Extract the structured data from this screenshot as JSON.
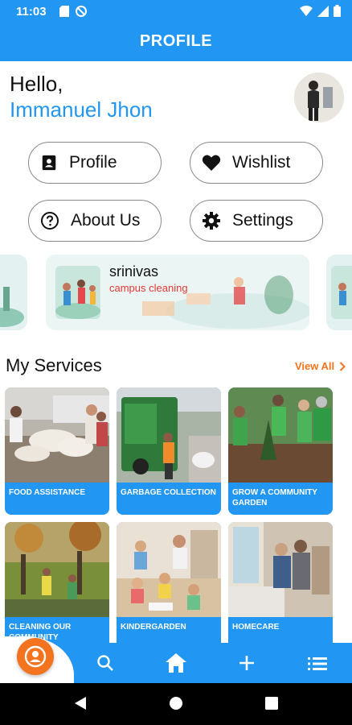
{
  "status_bar": {
    "time": "11:03"
  },
  "app_bar": {
    "title": "PROFILE"
  },
  "greeting": {
    "hello": "Hello,",
    "name": "Immanuel Jhon"
  },
  "menu": [
    {
      "label": "Profile",
      "icon": "contact-card-icon"
    },
    {
      "label": "Wishlist",
      "icon": "heart-icon"
    },
    {
      "label": "About Us",
      "icon": "help-circle-icon"
    },
    {
      "label": "Settings",
      "icon": "gear-icon"
    }
  ],
  "carousel": {
    "active": {
      "user": "srinivas",
      "description": "campus cleaning"
    }
  },
  "services": {
    "title": "My Services",
    "view_all": "View All",
    "items": [
      {
        "label": "FOOD ASSISTANCE"
      },
      {
        "label": "GARBAGE COLLECTION"
      },
      {
        "label": "GROW A COMMUNITY GARDEN"
      },
      {
        "label": "CLEANING OUR COMMUNITY"
      },
      {
        "label": "KINDERGARDEN"
      },
      {
        "label": "HOMECARE"
      }
    ]
  },
  "bottom_nav": {
    "items": [
      "account-icon",
      "search-icon",
      "home-icon",
      "add-icon",
      "list-icon"
    ]
  },
  "colors": {
    "primary": "#2196f3",
    "accent": "#f4731f",
    "danger": "#e53935"
  }
}
